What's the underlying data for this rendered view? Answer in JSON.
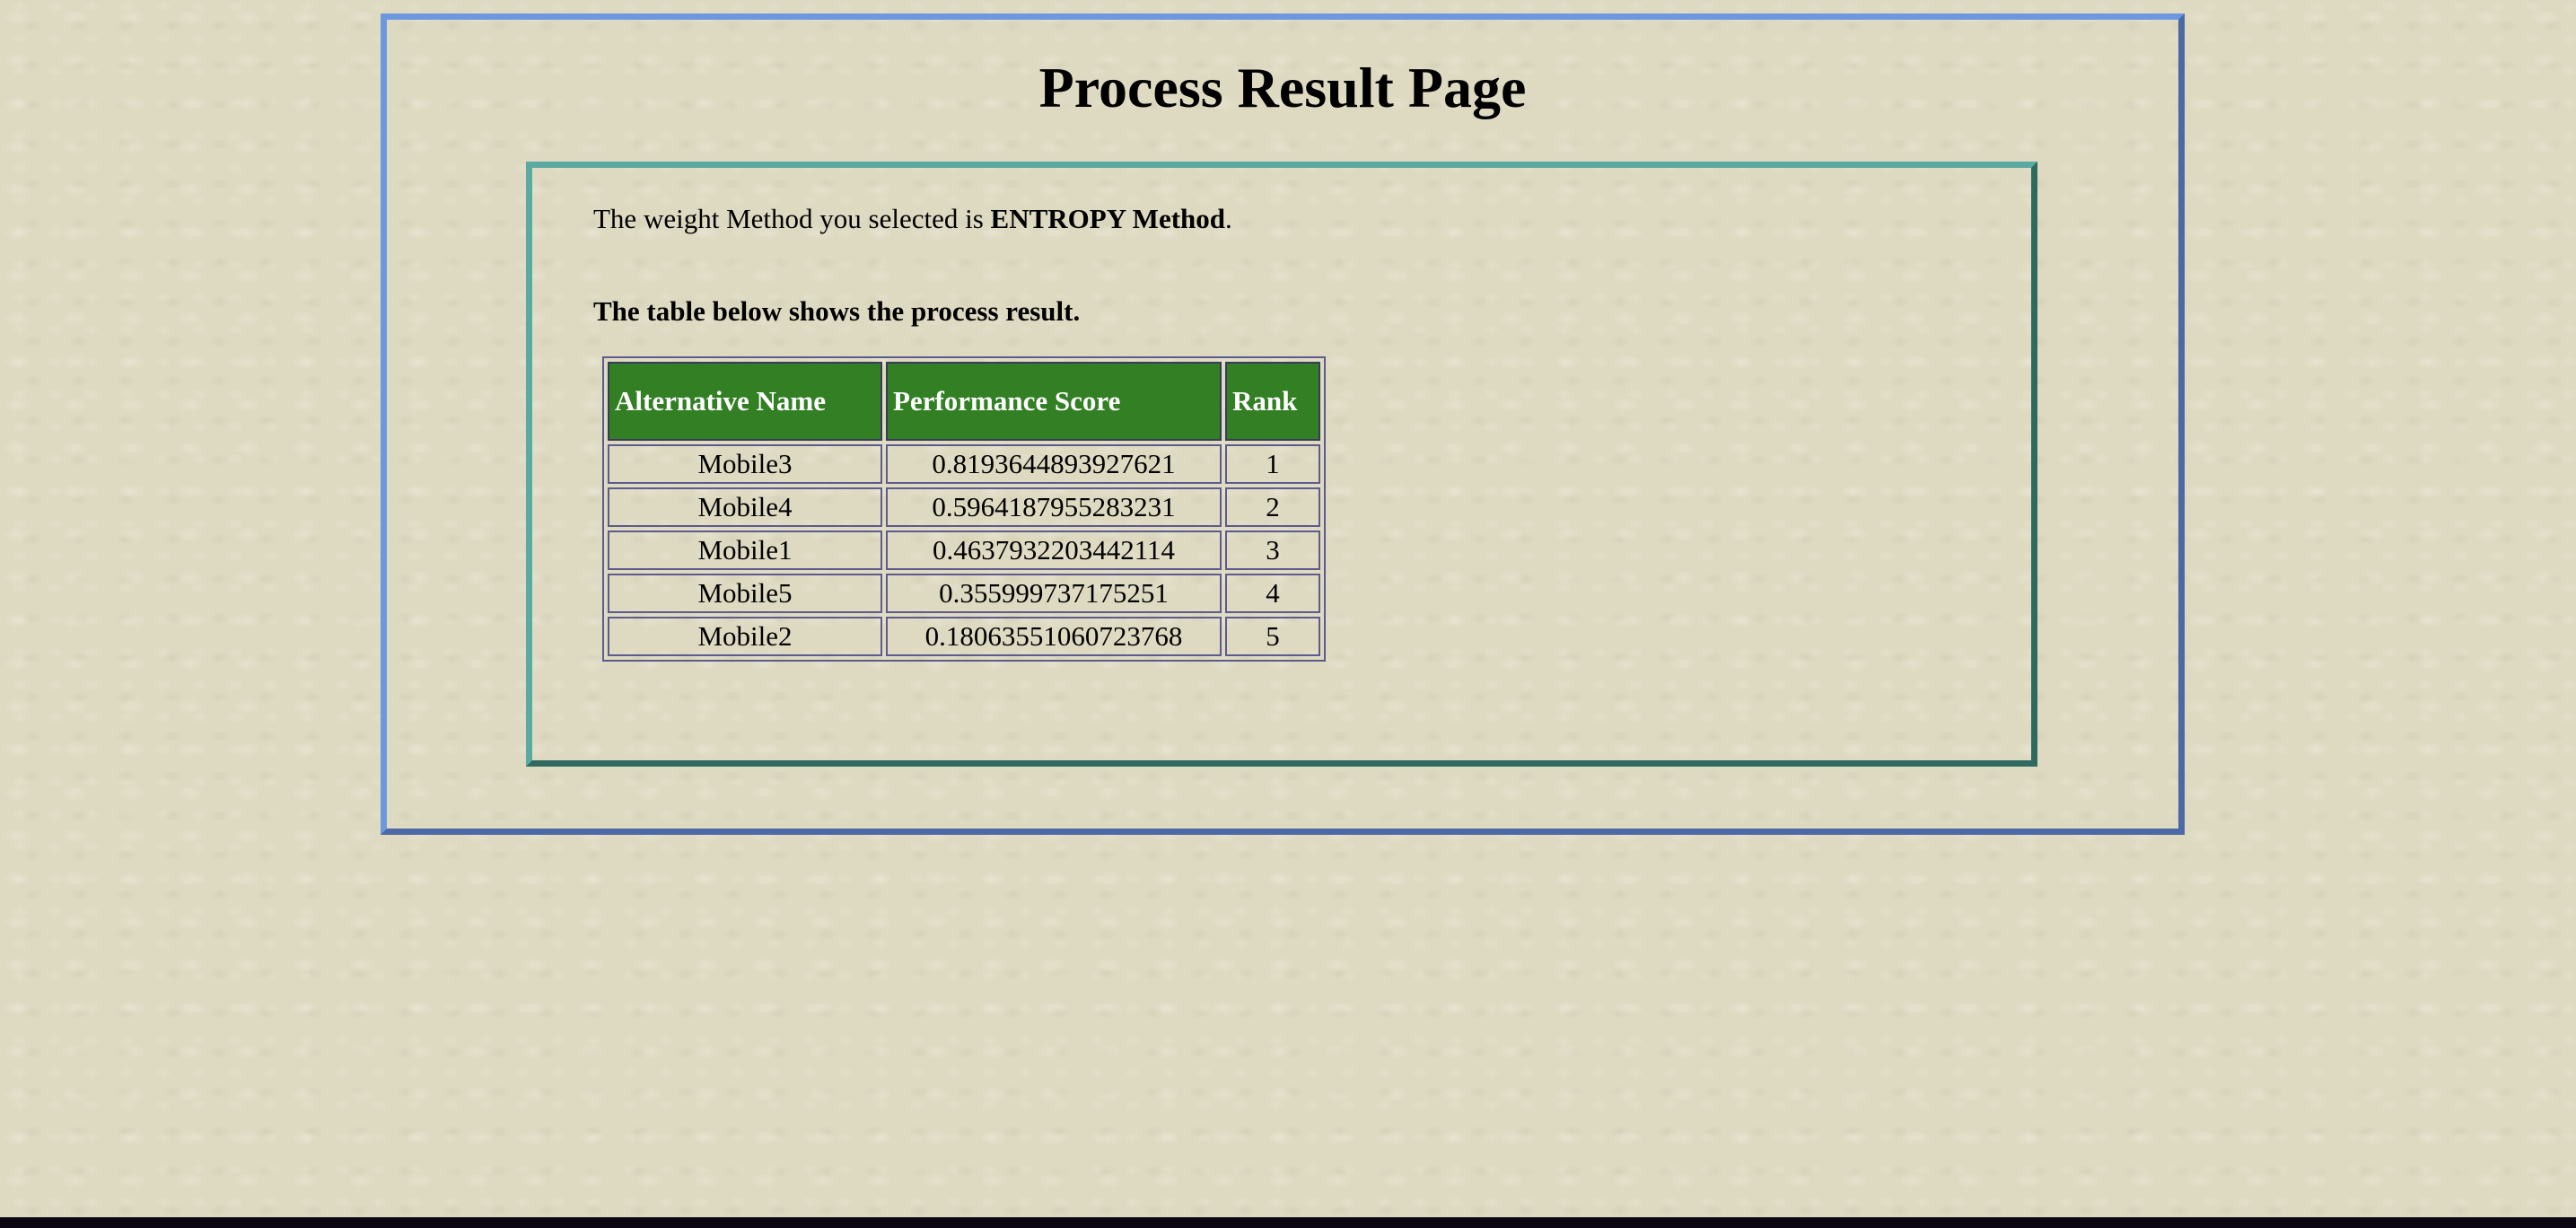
{
  "page": {
    "title": "Process Result Page"
  },
  "method": {
    "prefix": "The weight Method you selected is ",
    "name": "ENTROPY Method",
    "suffix": "."
  },
  "table": {
    "caption": "The table below shows the process result.",
    "headers": [
      "Alternative Name",
      "Performance Score",
      "Rank"
    ],
    "rows": [
      {
        "name": "Mobile3",
        "score": "0.8193644893927621",
        "rank": "1"
      },
      {
        "name": "Mobile4",
        "score": "0.5964187955283231",
        "rank": "2"
      },
      {
        "name": "Mobile1",
        "score": "0.4637932203442114",
        "rank": "3"
      },
      {
        "name": "Mobile5",
        "score": "0.355999737175251",
        "rank": "4"
      },
      {
        "name": "Mobile2",
        "score": "0.18063551060723768",
        "rank": "5"
      }
    ]
  },
  "colors": {
    "page_background": "#dedac2",
    "outer_border": "#6d98e0",
    "inner_border": "#5aaaa2",
    "header_background": "#327f24",
    "header_text": "#ffffff"
  }
}
